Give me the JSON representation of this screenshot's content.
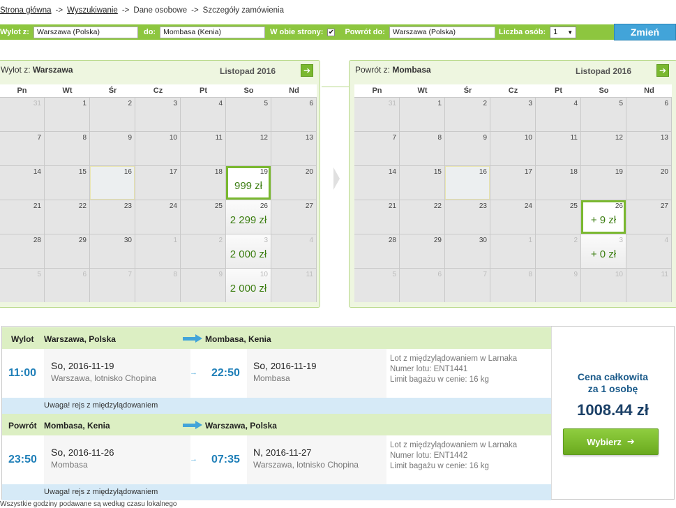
{
  "breadcrumb": {
    "items": [
      "Strona główna",
      "Wyszukiwanie",
      "Dane osobowe",
      "Szczegóły zamówienia"
    ],
    "separator": "->"
  },
  "search": {
    "from_label": "Wylot z:",
    "from_value": "Warszawa (Polska)",
    "to_label": "do:",
    "to_value": "Mombasa (Kenia)",
    "roundtrip_label": "W obie strony:",
    "roundtrip_checked": true,
    "return_label": "Powrót do:",
    "return_value": "Warszawa (Polska)",
    "people_label": "Liczba osób:",
    "people_value": "1",
    "change_button": "Zmień"
  },
  "outbound_calendar": {
    "title_prefix": "Wylot z:",
    "title_city": "Warszawa",
    "month": "Listopad 2016",
    "weekdays": [
      "Pn",
      "Wt",
      "Śr",
      "Cz",
      "Pt",
      "So",
      "Nd"
    ],
    "days": [
      {
        "n": "31",
        "other": true
      },
      {
        "n": "1"
      },
      {
        "n": "2"
      },
      {
        "n": "3"
      },
      {
        "n": "4"
      },
      {
        "n": "5"
      },
      {
        "n": "6"
      },
      {
        "n": "7"
      },
      {
        "n": "8"
      },
      {
        "n": "9"
      },
      {
        "n": "10"
      },
      {
        "n": "11"
      },
      {
        "n": "12"
      },
      {
        "n": "13"
      },
      {
        "n": "14"
      },
      {
        "n": "15"
      },
      {
        "n": "16",
        "today": true
      },
      {
        "n": "17"
      },
      {
        "n": "18"
      },
      {
        "n": "19",
        "price": "999 zł",
        "selected": true
      },
      {
        "n": "20"
      },
      {
        "n": "21"
      },
      {
        "n": "22"
      },
      {
        "n": "23"
      },
      {
        "n": "24"
      },
      {
        "n": "25"
      },
      {
        "n": "26",
        "price": "2 299 zł"
      },
      {
        "n": "27"
      },
      {
        "n": "28"
      },
      {
        "n": "29"
      },
      {
        "n": "30"
      },
      {
        "n": "1",
        "other": true
      },
      {
        "n": "2",
        "other": true
      },
      {
        "n": "3",
        "other": true,
        "price": "2 000 zł"
      },
      {
        "n": "4",
        "other": true
      },
      {
        "n": "5",
        "other": true
      },
      {
        "n": "6",
        "other": true
      },
      {
        "n": "7",
        "other": true
      },
      {
        "n": "8",
        "other": true
      },
      {
        "n": "9",
        "other": true
      },
      {
        "n": "10",
        "other": true,
        "price": "2 000 zł"
      },
      {
        "n": "11",
        "other": true
      }
    ]
  },
  "return_calendar": {
    "title_prefix": "Powrót z:",
    "title_city": "Mombasa",
    "month": "Listopad 2016",
    "weekdays": [
      "Pn",
      "Wt",
      "Śr",
      "Cz",
      "Pt",
      "So",
      "Nd"
    ],
    "days": [
      {
        "n": "31",
        "other": true
      },
      {
        "n": "1"
      },
      {
        "n": "2"
      },
      {
        "n": "3"
      },
      {
        "n": "4"
      },
      {
        "n": "5"
      },
      {
        "n": "6"
      },
      {
        "n": "7"
      },
      {
        "n": "8"
      },
      {
        "n": "9"
      },
      {
        "n": "10"
      },
      {
        "n": "11"
      },
      {
        "n": "12"
      },
      {
        "n": "13"
      },
      {
        "n": "14"
      },
      {
        "n": "15"
      },
      {
        "n": "16",
        "today": true
      },
      {
        "n": "17"
      },
      {
        "n": "18"
      },
      {
        "n": "19"
      },
      {
        "n": "20"
      },
      {
        "n": "21"
      },
      {
        "n": "22"
      },
      {
        "n": "23"
      },
      {
        "n": "24"
      },
      {
        "n": "25"
      },
      {
        "n": "26",
        "price": "+ 9 zł",
        "selected": true
      },
      {
        "n": "27"
      },
      {
        "n": "28"
      },
      {
        "n": "29"
      },
      {
        "n": "30"
      },
      {
        "n": "1",
        "other": true
      },
      {
        "n": "2",
        "other": true
      },
      {
        "n": "3",
        "other": true,
        "price": "+ 0 zł"
      },
      {
        "n": "4",
        "other": true
      },
      {
        "n": "5",
        "other": true
      },
      {
        "n": "6",
        "other": true
      },
      {
        "n": "7",
        "other": true
      },
      {
        "n": "8",
        "other": true
      },
      {
        "n": "9",
        "other": true
      },
      {
        "n": "10",
        "other": true
      },
      {
        "n": "11",
        "other": true
      }
    ]
  },
  "outbound_leg": {
    "label": "Wylot",
    "from": "Warszawa, Polska",
    "to": "Mombasa, Kenia",
    "dep_time": "11:00",
    "dep_day": "So,",
    "dep_date": "2016-11-19",
    "dep_airport": "Warszawa, lotnisko Chopina",
    "arr_time": "22:50",
    "arr_day": "So,",
    "arr_date": "2016-11-19",
    "arr_airport": "Mombasa",
    "info_1": "Lot z międzylądowaniem w Larnaka",
    "info_2": "Numer lotu: ENT1441",
    "info_3": "Limit bagażu w cenie: 16 kg",
    "warning": "Uwaga! rejs z międzylądowaniem"
  },
  "return_leg": {
    "label": "Powrót",
    "from": "Mombasa, Kenia",
    "to": "Warszawa, Polska",
    "dep_time": "23:50",
    "dep_day": "So,",
    "dep_date": "2016-11-26",
    "dep_airport": "Mombasa",
    "arr_time": "07:35",
    "arr_day": "N,",
    "arr_date": "2016-11-27",
    "arr_airport": "Warszawa, lotnisko Chopina",
    "info_1": "Lot z międzylądowaniem w Larnaka",
    "info_2": "Numer lotu: ENT1442",
    "info_3": "Limit bagażu w cenie: 16 kg",
    "warning": "Uwaga! rejs z międzylądowaniem"
  },
  "price": {
    "label_1": "Cena całkowita",
    "label_2": "za 1 osobę",
    "value": "1008.44 zł",
    "choose_button": "Wybierz"
  },
  "footer_note": "Wszystkie godziny podawane są według czasu lokalnego",
  "colors": {
    "accent_green": "#8dc63f",
    "accent_blue": "#42a4d9",
    "price_green": "#3b7d10"
  }
}
